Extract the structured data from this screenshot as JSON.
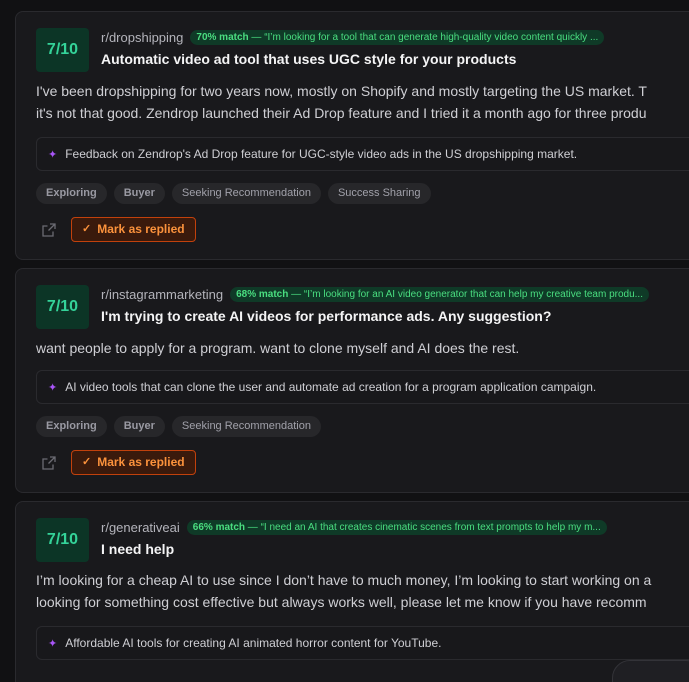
{
  "cards": [
    {
      "score": "7/10",
      "subreddit": "r/dropshipping",
      "match_pct": "70% match",
      "match_quote": " — “I’m looking for a tool that can generate high-quality video content quickly ...",
      "title": "Automatic video ad tool that uses UGC style for your products",
      "body_lines": [
        "I've been dropshipping for two years now, mostly on Shopify and mostly targeting the US market. T",
        "it's not that good. Zendrop launched their Ad Drop feature and I tried it a month ago for three produ"
      ],
      "summary": "Feedback on Zendrop's Ad Drop feature for UGC-style video ads in the US dropshipping market.",
      "tags": [
        "Exploring",
        "Buyer",
        "Seeking Recommendation",
        "Success Sharing"
      ],
      "reply_label": "Mark as replied"
    },
    {
      "score": "7/10",
      "subreddit": "r/instagrammarketing",
      "match_pct": "68% match",
      "match_quote": " — “I’m looking for an AI video generator that can help my creative team produ...",
      "title": "I'm trying to create AI videos for performance ads. Any suggestion?",
      "body_lines": [
        "want people to apply for a program. want to clone myself and AI does the rest."
      ],
      "summary": "AI video tools that can clone the user and automate ad creation for a program application campaign.",
      "tags": [
        "Exploring",
        "Buyer",
        "Seeking Recommendation"
      ],
      "reply_label": "Mark as replied"
    },
    {
      "score": "7/10",
      "subreddit": "r/generativeai",
      "match_pct": "66% match",
      "match_quote": " — “I need an AI that creates cinematic scenes from text prompts to help my m...",
      "title": "I need help",
      "body_lines": [
        "I’m looking for a cheap AI to use since I don’t have to much money, I’m looking to start working on a",
        "looking for something cost effective but always works well, please let me know if you have recomm"
      ],
      "summary": "Affordable AI tools for creating AI animated horror content for YouTube."
    }
  ],
  "colors": {
    "score_bg": "#0c3526",
    "score_text": "#34d399",
    "match_text": "#4ade80",
    "reply_border": "#c2410c",
    "reply_text": "#fb923c",
    "sparkle": "#a855f7"
  },
  "icons": {
    "share": "external-share-icon",
    "check": "check-icon",
    "sparkle": "sparkle-icon"
  }
}
